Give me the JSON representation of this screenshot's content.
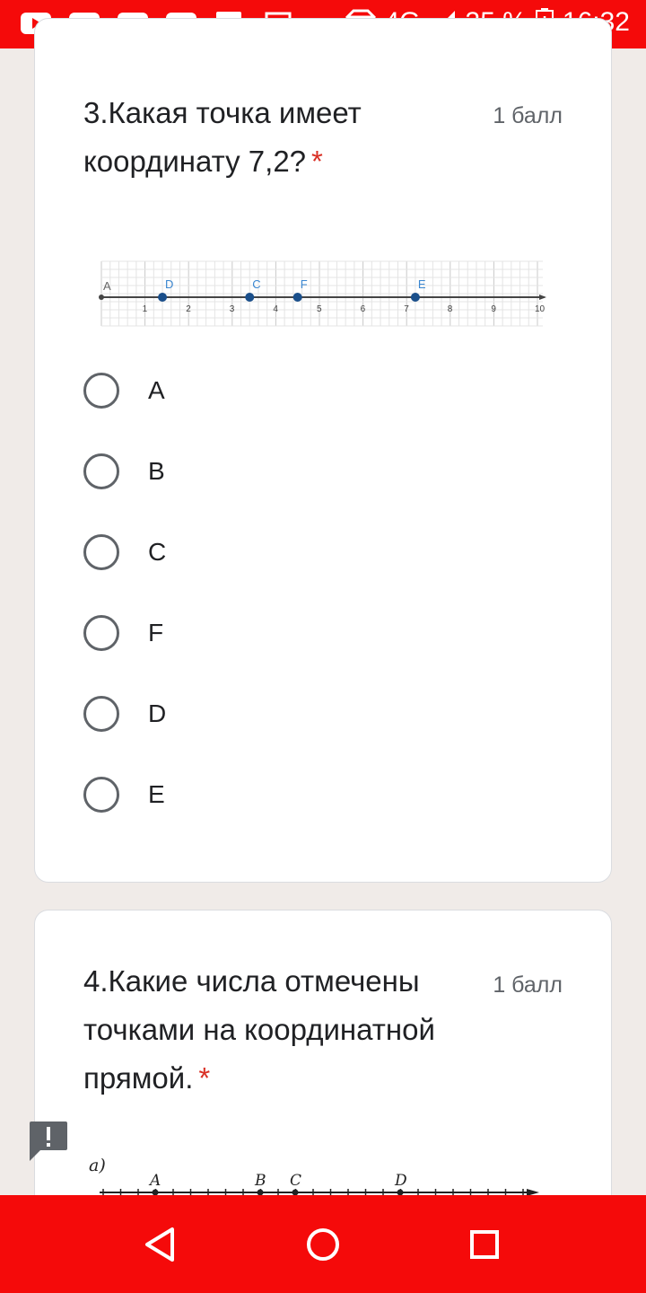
{
  "status_bar": {
    "notification_icons": [
      "youtube-icon",
      "youtube-icon",
      "youtube-icon",
      "youtube-icon",
      "gallery-icon",
      "laptop-icon"
    ],
    "network": "4G",
    "battery": "35 %",
    "time": "16:32"
  },
  "question3": {
    "title": "3.Какая точка имеет координату 7,2?",
    "required_mark": "*",
    "points": "1 балл",
    "number_line": {
      "ticks": [
        "1",
        "2",
        "3",
        "4",
        "5",
        "6",
        "7",
        "8",
        "9",
        "10"
      ],
      "points": [
        {
          "label": "A",
          "value": 0
        },
        {
          "label": "D",
          "value": 1.4
        },
        {
          "label": "C",
          "value": 3.4
        },
        {
          "label": "F",
          "value": 4.5
        },
        {
          "label": "E",
          "value": 7.2
        }
      ]
    },
    "options": [
      "A",
      "B",
      "C",
      "F",
      "D",
      "E"
    ]
  },
  "question4": {
    "title": "4.Какие числа отмечены точками на координатной прямой.",
    "required_mark": "*",
    "points": "1 балл",
    "image": {
      "part_label": "а)",
      "points": [
        "A",
        "B",
        "C",
        "D"
      ]
    }
  },
  "colors": {
    "status_bar": "#f50a0a",
    "required": "#d93025",
    "point_fill": "#1a4f8b",
    "point_label": "#3a86d0"
  },
  "navigation": [
    "back-icon",
    "home-icon",
    "recents-icon"
  ]
}
